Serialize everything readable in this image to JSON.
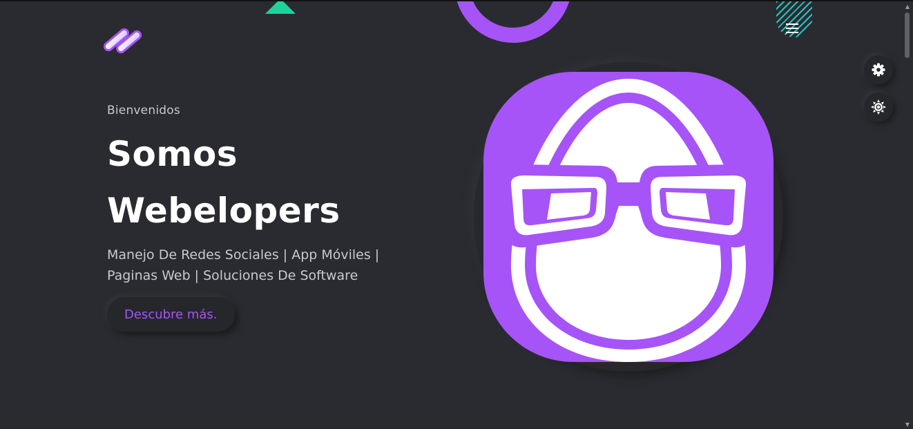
{
  "hero": {
    "welcome": "Bienvenidos",
    "title_line1": "Somos",
    "title_line2": "Webelopers",
    "subtitle": "Manejo De Redes Sociales | App Móviles | Paginas Web | Soluciones De Software",
    "cta_label": "Descubre más."
  },
  "icons": {
    "logo": "webelopers-logo-icon",
    "menu": "hamburger-menu-icon",
    "settings": "gear-icon",
    "theme": "sun-icon",
    "avatar": "egg-with-glasses-icon"
  },
  "colors": {
    "background": "#2a2b30",
    "accent": "#a654f7",
    "deco_green": "#1ed39a",
    "deco_teal": "#23c4c4",
    "text_primary": "#ffffff",
    "text_secondary": "#c9c9ce"
  }
}
